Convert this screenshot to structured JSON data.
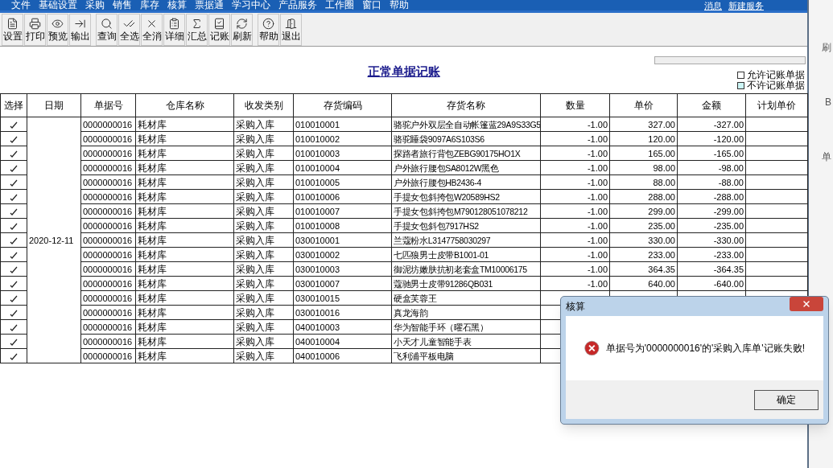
{
  "menu_bar": {
    "items": [
      "文件",
      "基础设置",
      "采购",
      "销售",
      "库存",
      "核算",
      "票据通",
      "学习中心",
      "产品服务",
      "工作圈",
      "窗口",
      "帮助"
    ],
    "right_links": [
      "消息",
      "新建服务"
    ]
  },
  "toolbar": {
    "groups": [
      [
        "设置",
        "打印",
        "预览",
        "输出"
      ],
      [
        "查询",
        "全选",
        "全消",
        "详细",
        "汇总",
        "记账",
        "刷新"
      ],
      [
        "帮助",
        "退出"
      ]
    ]
  },
  "title": "正常单据记账",
  "legend": [
    {
      "label": "允许记账单据",
      "color": "#ffffff"
    },
    {
      "label": "不许记账单据",
      "color": "#ccf5f5"
    }
  ],
  "table": {
    "columns": [
      "选择",
      "日期",
      "单据号",
      "仓库名称",
      "收发类别",
      "存货编码",
      "存货名称",
      "数量",
      "单价",
      "金额",
      "计划单价"
    ],
    "date": "2020-12-11",
    "rows": [
      {
        "selected": true,
        "doc_no": "0000000016",
        "warehouse": "耗材库",
        "category": "采购入库",
        "code": "010010001",
        "name": "骆驼户外双层全自动帐篷蓝29A9S33G5",
        "qty": "-1.00",
        "price": "327.00",
        "amount": "-327.00"
      },
      {
        "selected": true,
        "doc_no": "0000000016",
        "warehouse": "耗材库",
        "category": "采购入库",
        "code": "010010002",
        "name": "骆驼睡袋9097A6S103S6",
        "qty": "-1.00",
        "price": "120.00",
        "amount": "-120.00"
      },
      {
        "selected": true,
        "doc_no": "0000000016",
        "warehouse": "耗材库",
        "category": "采购入库",
        "code": "010010003",
        "name": "探路者旅行背包ZEBG90175HO1X",
        "qty": "-1.00",
        "price": "165.00",
        "amount": "-165.00"
      },
      {
        "selected": true,
        "doc_no": "0000000016",
        "warehouse": "耗材库",
        "category": "采购入库",
        "code": "010010004",
        "name": "户外旅行腰包SA8012W黑色",
        "qty": "-1.00",
        "price": "98.00",
        "amount": "-98.00"
      },
      {
        "selected": true,
        "doc_no": "0000000016",
        "warehouse": "耗材库",
        "category": "采购入库",
        "code": "010010005",
        "name": "户外旅行腰包HB2436-4",
        "qty": "-1.00",
        "price": "88.00",
        "amount": "-88.00"
      },
      {
        "selected": true,
        "doc_no": "0000000016",
        "warehouse": "耗材库",
        "category": "采购入库",
        "code": "010010006",
        "name": "手提女包斜挎包W20589HS2",
        "qty": "-1.00",
        "price": "288.00",
        "amount": "-288.00"
      },
      {
        "selected": true,
        "doc_no": "0000000016",
        "warehouse": "耗材库",
        "category": "采购入库",
        "code": "010010007",
        "name": "手提女包斜挎包M790128051078212",
        "qty": "-1.00",
        "price": "299.00",
        "amount": "-299.00"
      },
      {
        "selected": true,
        "doc_no": "0000000016",
        "warehouse": "耗材库",
        "category": "采购入库",
        "code": "010010008",
        "name": "手提女包斜包7917HS2",
        "qty": "-1.00",
        "price": "235.00",
        "amount": "-235.00"
      },
      {
        "selected": true,
        "doc_no": "0000000016",
        "warehouse": "耗材库",
        "category": "采购入库",
        "code": "030010001",
        "name": "兰蔻粉水L3147758030297",
        "qty": "-1.00",
        "price": "330.00",
        "amount": "-330.00"
      },
      {
        "selected": true,
        "doc_no": "0000000016",
        "warehouse": "耗材库",
        "category": "采购入库",
        "code": "030010002",
        "name": "七匹狼男士皮带B1001-01",
        "qty": "-1.00",
        "price": "233.00",
        "amount": "-233.00"
      },
      {
        "selected": true,
        "doc_no": "0000000016",
        "warehouse": "耗材库",
        "category": "采购入库",
        "code": "030010003",
        "name": "御泥坊嫩肤抗初老套盒TM10006175",
        "qty": "-1.00",
        "price": "364.35",
        "amount": "-364.35"
      },
      {
        "selected": true,
        "doc_no": "0000000016",
        "warehouse": "耗材库",
        "category": "采购入库",
        "code": "030010007",
        "name": "蔻驰男士皮带91286QB031",
        "qty": "-1.00",
        "price": "640.00",
        "amount": "-640.00"
      },
      {
        "selected": true,
        "doc_no": "0000000016",
        "warehouse": "耗材库",
        "category": "采购入库",
        "code": "030010015",
        "name": "硬盒芙蓉王"
      },
      {
        "selected": true,
        "doc_no": "0000000016",
        "warehouse": "耗材库",
        "category": "采购入库",
        "code": "030010016",
        "name": "真龙海韵"
      },
      {
        "selected": true,
        "doc_no": "0000000016",
        "warehouse": "耗材库",
        "category": "采购入库",
        "code": "040010003",
        "name": "华为智能手环（曜石黑）"
      },
      {
        "selected": true,
        "doc_no": "0000000016",
        "warehouse": "耗材库",
        "category": "采购入库",
        "code": "040010004",
        "name": "小天才儿童智能手表"
      },
      {
        "selected": true,
        "doc_no": "0000000016",
        "warehouse": "耗材库",
        "category": "采购入库",
        "code": "040010006",
        "name": "飞利浦平板电脑"
      }
    ]
  },
  "side_window": {
    "labels": [
      "刷",
      "B",
      "单"
    ]
  },
  "dialog": {
    "title": "核算",
    "message": "单据号为'0000000016'的'采购入库单'记账失败!",
    "button": "确定"
  }
}
